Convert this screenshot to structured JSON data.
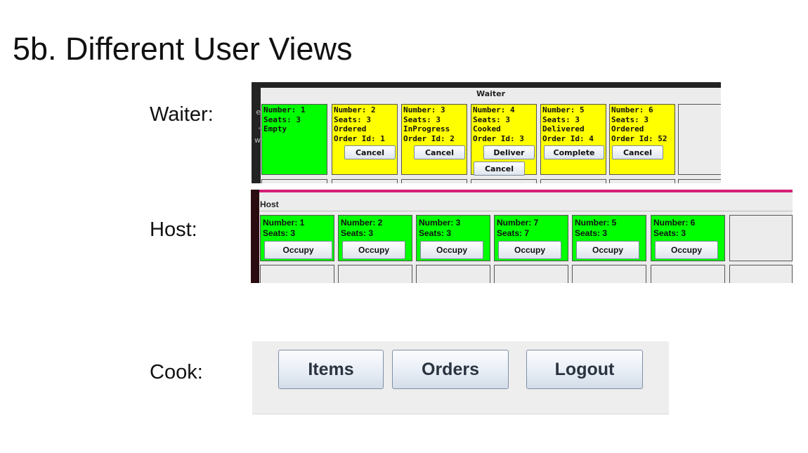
{
  "slide": {
    "title": "5b.  Different User Views",
    "labels": {
      "waiter": "Waiter:",
      "host": "Host:",
      "cook": "Cook:"
    }
  },
  "waiter": {
    "window_title": "Waiter",
    "bleed_chars": [
      "e p",
      ", A",
      "w"
    ],
    "tiles": [
      {
        "lines": "Number: 1\nSeats: 3\nEmpty",
        "color": "#00ff00",
        "buttons": []
      },
      {
        "lines": "Number: 2\nSeats: 3\nOrdered\nOrder Id: 1",
        "color": "#ffff00",
        "buttons": [
          "Cancel"
        ]
      },
      {
        "lines": "Number: 3\nSeats: 3\nInProgress\nOrder Id: 2",
        "color": "#ffff00",
        "buttons": [
          "Cancel"
        ]
      },
      {
        "lines": "Number: 4\nSeats: 3\nCooked\nOrder Id: 3",
        "color": "#ffff00",
        "buttons": [
          "Deliver",
          "Cancel"
        ]
      },
      {
        "lines": "Number: 5\nSeats: 3\nDelivered\nOrder Id: 4",
        "color": "#ffff00",
        "buttons": [
          "Complete"
        ]
      },
      {
        "lines": "Number: 6\nSeats: 3\nOrdered\nOrder Id: 52",
        "color": "#ffff00",
        "buttons": [
          "Cancel"
        ]
      },
      {
        "lines": "",
        "color": "#ececec",
        "buttons": []
      }
    ]
  },
  "host": {
    "window_title": "Host",
    "tiles": [
      {
        "lines": "Number: 1\nSeats: 3",
        "color": "#00ff00",
        "button": "Occupy"
      },
      {
        "lines": "Number: 2\nSeats: 3",
        "color": "#00ff00",
        "button": "Occupy"
      },
      {
        "lines": "Number: 3\nSeats: 3",
        "color": "#00ff00",
        "button": "Occupy"
      },
      {
        "lines": "Number: 7\nSeats: 7",
        "color": "#00ff00",
        "button": "Occupy"
      },
      {
        "lines": "Number: 5\nSeats: 3",
        "color": "#00ff00",
        "button": "Occupy"
      },
      {
        "lines": "Number: 6\nSeats: 3",
        "color": "#00ff00",
        "button": "Occupy"
      },
      {
        "lines": "",
        "color": "#ececec",
        "button": ""
      }
    ]
  },
  "cook": {
    "buttons": [
      "Items",
      "Orders",
      "Logout"
    ]
  }
}
